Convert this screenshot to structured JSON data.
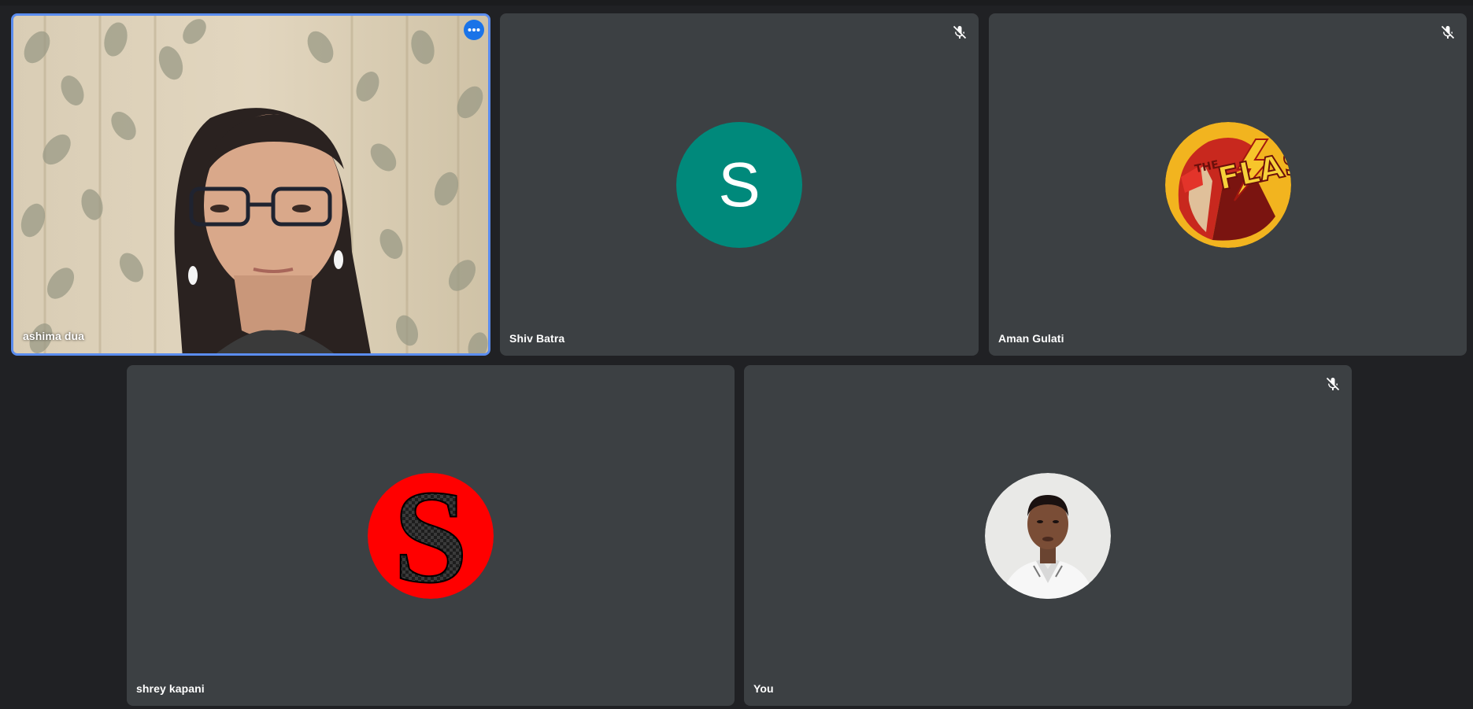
{
  "participants": [
    {
      "name": "ashima dua",
      "muted": false,
      "active_speaker": true,
      "avatar_type": "video"
    },
    {
      "name": "Shiv Batra",
      "muted": true,
      "avatar_letter": "S",
      "avatar_color": "#00897b"
    },
    {
      "name": "Aman Gulati",
      "muted": true,
      "avatar_image": "the-flash-avatar",
      "avatar_text": "THE FLASH"
    },
    {
      "name": "shrey kapani",
      "muted": false,
      "avatar_image": "red-s-logo-avatar",
      "avatar_text": "S"
    },
    {
      "name": "You",
      "muted": true,
      "avatar_image": "profile-photo-avatar"
    }
  ],
  "colors": {
    "background": "#202124",
    "tile": "#3c4043",
    "active_border": "#5b8def",
    "more_button": "#1a73e8"
  }
}
